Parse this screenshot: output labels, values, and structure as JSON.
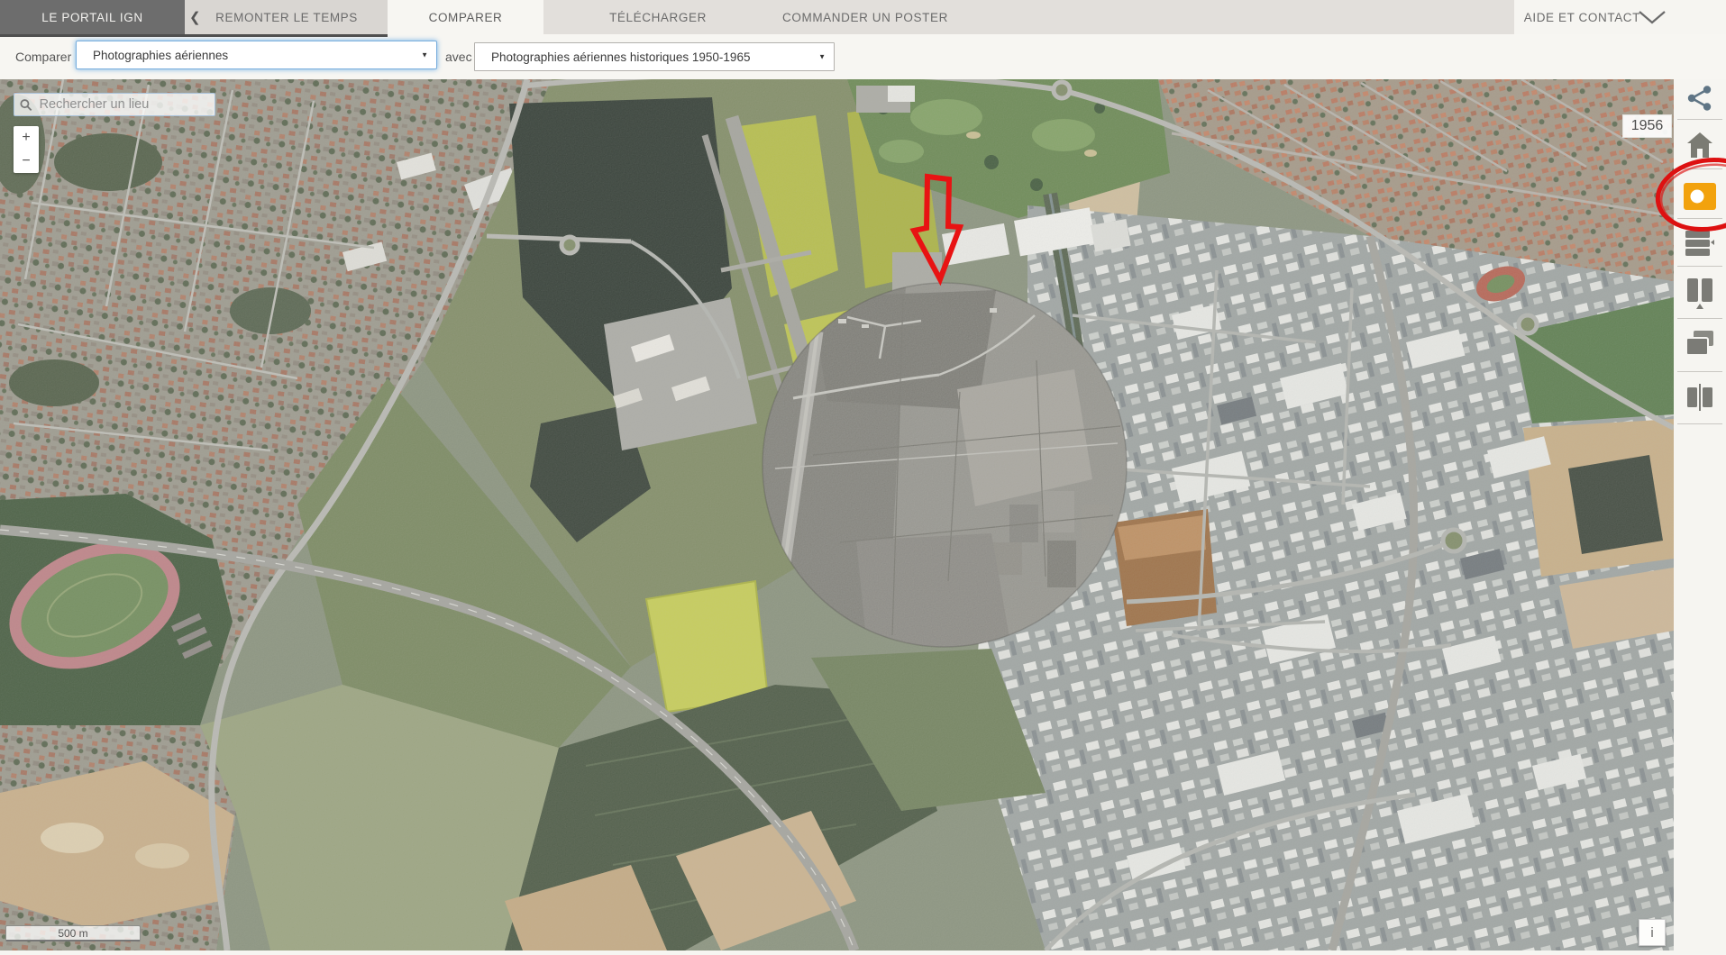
{
  "header": {
    "portal_label": "LE PORTAIL IGN",
    "back_tab": "REMONTER LE TEMPS",
    "tab_comparer": "COMPARER",
    "tab_telecharger": "TÉLÉCHARGER",
    "tab_poster": "COMMANDER UN POSTER",
    "help_label": "AIDE ET CONTACT"
  },
  "icons": {
    "back_chevron": "❮",
    "dropdown_arrow": "▼"
  },
  "compare_bar": {
    "compare_label": "Comparer",
    "left_select_value": "Photographies aériennes",
    "with_label": "avec",
    "right_select_value": "Photographies aériennes historiques 1950-1965"
  },
  "map_ui": {
    "search_placeholder": "Rechercher un lieu",
    "zoom_in": "+",
    "zoom_out": "−",
    "year_badge": "1956",
    "scale_label": "500 m",
    "info_label": "i"
  },
  "sidebar": {
    "icons": [
      {
        "name": "share-icon"
      },
      {
        "name": "home-icon"
      },
      {
        "name": "photos-icon",
        "active": true
      },
      {
        "name": "layers-icon"
      },
      {
        "name": "swipe-view-icon"
      },
      {
        "name": "overlay-view-icon"
      },
      {
        "name": "side-by-side-icon"
      }
    ]
  },
  "annotations": {
    "arrow_color": "#e81313",
    "circle_color": "#dd1111"
  },
  "colors": {
    "header_bg": "#e2dfdb",
    "header_dark": "#6d6d6d",
    "active_tab_bg": "#f7f6f2",
    "panel_bg": "#f6f5f1",
    "accent_orange": "#f2a20d",
    "focus_blue": "#79aedd"
  }
}
